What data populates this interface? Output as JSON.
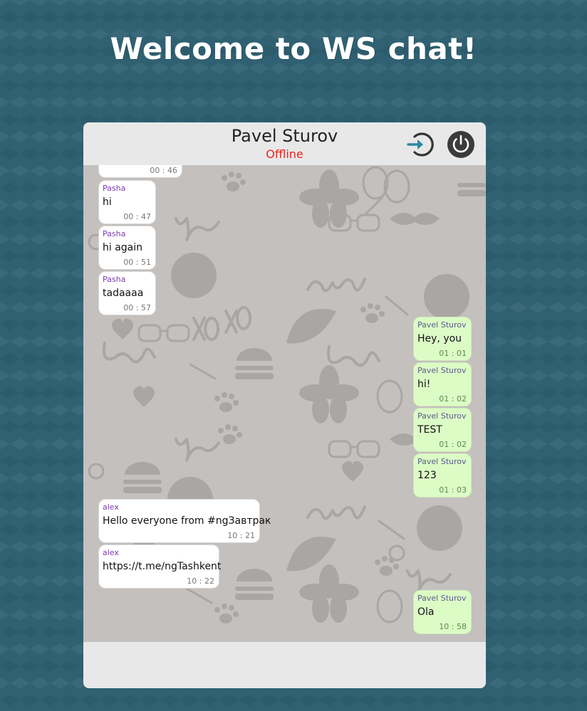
{
  "page": {
    "heading": "Welcome to WS chat!"
  },
  "header": {
    "contact_name": "Pavel Sturov",
    "status": "Offline",
    "status_color": "#e8231c",
    "logout_icon": "logout-icon",
    "power_icon": "power-icon"
  },
  "colors": {
    "page_background": "#2f6172",
    "chat_background": "#c4c0bd",
    "incoming_bubble": "#ffffff",
    "outgoing_bubble": "#dcfcc6",
    "incoming_author": "#7c3ab1",
    "outgoing_author": "#5a5a8a"
  },
  "messages": [
    {
      "direction": "in",
      "author": "",
      "text": "",
      "time": "00 : 46"
    },
    {
      "direction": "in",
      "author": "Pasha",
      "text": "hi",
      "time": "00 : 47"
    },
    {
      "direction": "in",
      "author": "Pasha",
      "text": "hi again",
      "time": "00 : 51"
    },
    {
      "direction": "in",
      "author": "Pasha",
      "text": "tadaaaa",
      "time": "00 : 57"
    },
    {
      "direction": "out",
      "author": "Pavel Sturov",
      "text": "Hey, you",
      "time": "01 : 01"
    },
    {
      "direction": "out",
      "author": "Pavel Sturov",
      "text": "hi!",
      "time": "01 : 02"
    },
    {
      "direction": "out",
      "author": "Pavel Sturov",
      "text": "TEST",
      "time": "01 : 02"
    },
    {
      "direction": "out",
      "author": "Pavel Sturov",
      "text": "123",
      "time": "01 : 03"
    },
    {
      "direction": "in",
      "author": "alex",
      "text": "Hello everyone from #ngЗавтрак",
      "time": "10 : 21"
    },
    {
      "direction": "in",
      "author": "alex",
      "text": "https://t.me/ngTashkent",
      "time": "10 : 22"
    },
    {
      "direction": "out",
      "author": "Pavel Sturov",
      "text": "Ola",
      "time": "10 : 58"
    }
  ]
}
